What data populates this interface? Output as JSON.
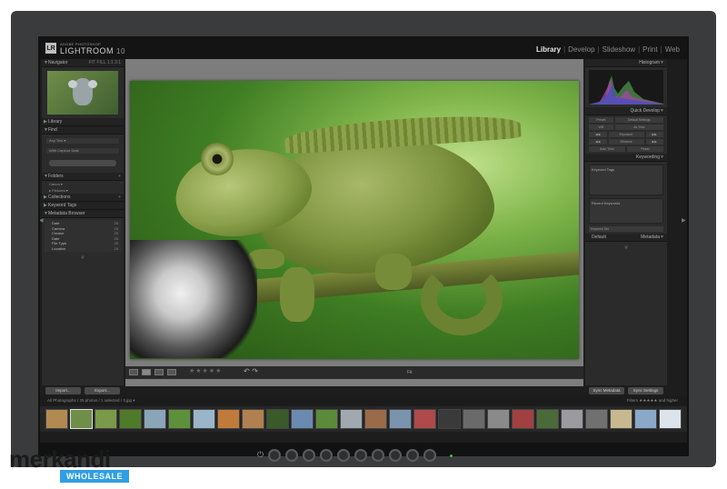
{
  "app": {
    "subtitle": "ADOBE PHOTOSHOP",
    "name": "LIGHTROOM",
    "version": "10",
    "logo_letters": "LR"
  },
  "modules": [
    "Library",
    "Develop",
    "Slideshow",
    "Print",
    "Web"
  ],
  "active_module": "Library",
  "left_panel": {
    "navigator": "Navigator",
    "navigator_zoom": "FIT  FILL  1:1  3:1",
    "library": "Library",
    "find": "Find",
    "find_rows": [
      "Any Text ▾",
      "With Capture Date"
    ],
    "folders": "Folders",
    "folder_rows": [
      "Canon ▾",
      "▸ Pictures ▾"
    ],
    "collections": "Collections",
    "keyword_tags": "Keyword Tags",
    "metadata_browser": "Metadata Browser",
    "metadata_rows": [
      {
        "label": "Date",
        "count": "25"
      },
      {
        "label": "Camera",
        "count": "25"
      },
      {
        "label": "Creator",
        "count": "25"
      },
      {
        "label": "Date",
        "count": "25"
      },
      {
        "label": "File Type",
        "count": "25"
      },
      {
        "label": "Location",
        "count": "25"
      }
    ],
    "import_button": "Import...",
    "export_button": "Export..."
  },
  "toolbar": {
    "stars": "★★★★★",
    "label": "Fit"
  },
  "right_panel": {
    "histogram": "Histogram",
    "quick_develop": "Quick Develop",
    "preset_label": "Preset",
    "preset_value": "Default Settings",
    "wb_label": "WB",
    "wb_value": "As Shot",
    "exposure_label": "Exposure",
    "vibrance_label": "Vibrance",
    "auto_tone": "Auto Tone",
    "reset": "Reset",
    "keywording": "Keywording",
    "keyword_tags": "Keyword Tags",
    "recent_keywords": "Recent Keywords",
    "keyword_set": "Keyword Set",
    "metadata": "Metadata",
    "metadata_preset": "Default",
    "sync_metadata": "Sync Metadata",
    "sync_settings": "Sync Settings"
  },
  "filmstrip": {
    "path": "All Photographs / 25 photos / 1 selected / 3.jpg ▾",
    "filter_label": "Filters",
    "filter_value": "and higher",
    "thumb_colors": [
      "#b08a50",
      "#6f8e4a",
      "#7a9a4a",
      "#4f7a2a",
      "#8aa4b8",
      "#5e8f3a",
      "#9ab4c8",
      "#c07a3a",
      "#b08050",
      "#3a5a2a",
      "#6a8ab0",
      "#5a8a3a",
      "#a0a8b0",
      "#9a6a4a",
      "#7a94b0",
      "#b04a4a",
      "#3a3a3a",
      "#6a6a6a",
      "#8a8a8a",
      "#a04040",
      "#4a6a3a",
      "#9a9aa0",
      "#707070",
      "#c8b890",
      "#8aa8c8",
      "#dde3ea"
    ]
  },
  "watermark": {
    "brand": "merkandi",
    "badge": "WHOLESALE"
  }
}
